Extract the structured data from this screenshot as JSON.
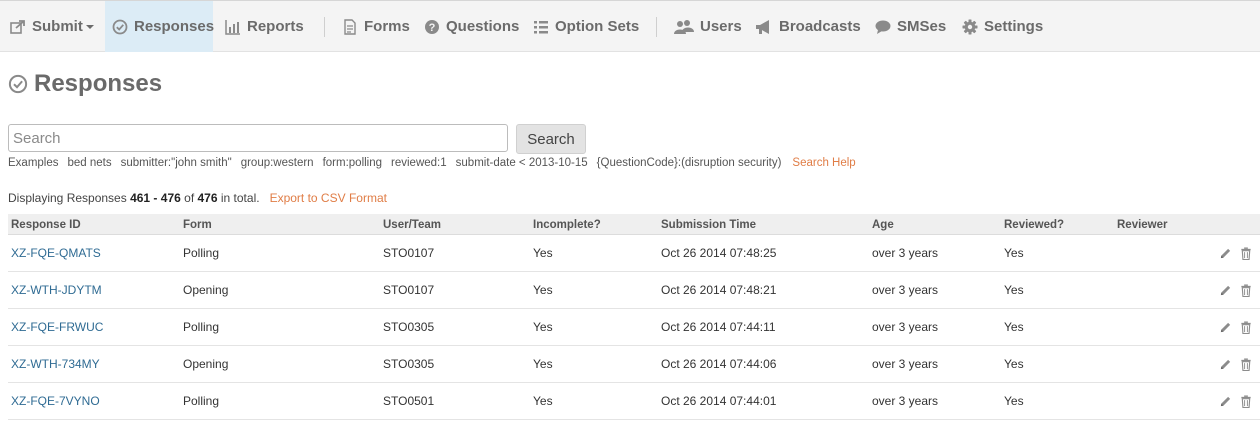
{
  "nav": {
    "submit": "Submit",
    "responses": "Responses",
    "reports": "Reports",
    "forms": "Forms",
    "questions": "Questions",
    "option_sets": "Option Sets",
    "users": "Users",
    "broadcasts": "Broadcasts",
    "smses": "SMSes",
    "settings": "Settings",
    "active": "Responses"
  },
  "page": {
    "title": "Responses"
  },
  "search": {
    "placeholder": "Search",
    "value": "",
    "button": "Search",
    "examples_label": "Examples",
    "examples": [
      "bed nets",
      "submitter:\"john smith\"",
      "group:western",
      "form:polling",
      "reviewed:1",
      "submit-date < 2013-10-15",
      "{QuestionCode}:(disruption security)"
    ],
    "help": "Search Help"
  },
  "summary": {
    "prefix": "Displaying Responses",
    "range": "461 - 476",
    "of": "of",
    "total": "476",
    "suffix": "in total.",
    "export": "Export to CSV Format"
  },
  "table": {
    "headers": [
      "Response ID",
      "Form",
      "User/Team",
      "Incomplete?",
      "Submission Time",
      "Age",
      "Reviewed?",
      "Reviewer"
    ],
    "rows": [
      [
        "XZ-FQE-QMATS",
        "Polling",
        "STO0107",
        "Yes",
        "Oct 26 2014 07:48:25",
        "over 3 years",
        "Yes",
        ""
      ],
      [
        "XZ-WTH-JDYTM",
        "Opening",
        "STO0107",
        "Yes",
        "Oct 26 2014 07:48:21",
        "over 3 years",
        "Yes",
        ""
      ],
      [
        "XZ-FQE-FRWUC",
        "Polling",
        "STO0305",
        "Yes",
        "Oct 26 2014 07:44:11",
        "over 3 years",
        "Yes",
        ""
      ],
      [
        "XZ-WTH-734MY",
        "Opening",
        "STO0305",
        "Yes",
        "Oct 26 2014 07:44:06",
        "over 3 years",
        "Yes",
        ""
      ],
      [
        "XZ-FQE-7VYNO",
        "Polling",
        "STO0501",
        "Yes",
        "Oct 26 2014 07:44:01",
        "over 3 years",
        "Yes",
        ""
      ]
    ]
  },
  "colors": {
    "link": "#2f6b93",
    "accent": "#e07d46",
    "active_tab": "#dcecf6",
    "nav_text": "#6b6b6b"
  },
  "icons": {
    "submit": "share-icon",
    "responses": "check-circle-icon",
    "reports": "bar-chart-icon",
    "forms": "document-icon",
    "questions": "question-circle-icon",
    "option_sets": "list-icon",
    "users": "users-icon",
    "broadcasts": "megaphone-icon",
    "smses": "speech-bubble-icon",
    "settings": "gear-icon",
    "edit": "pencil-icon",
    "delete": "trash-icon"
  }
}
